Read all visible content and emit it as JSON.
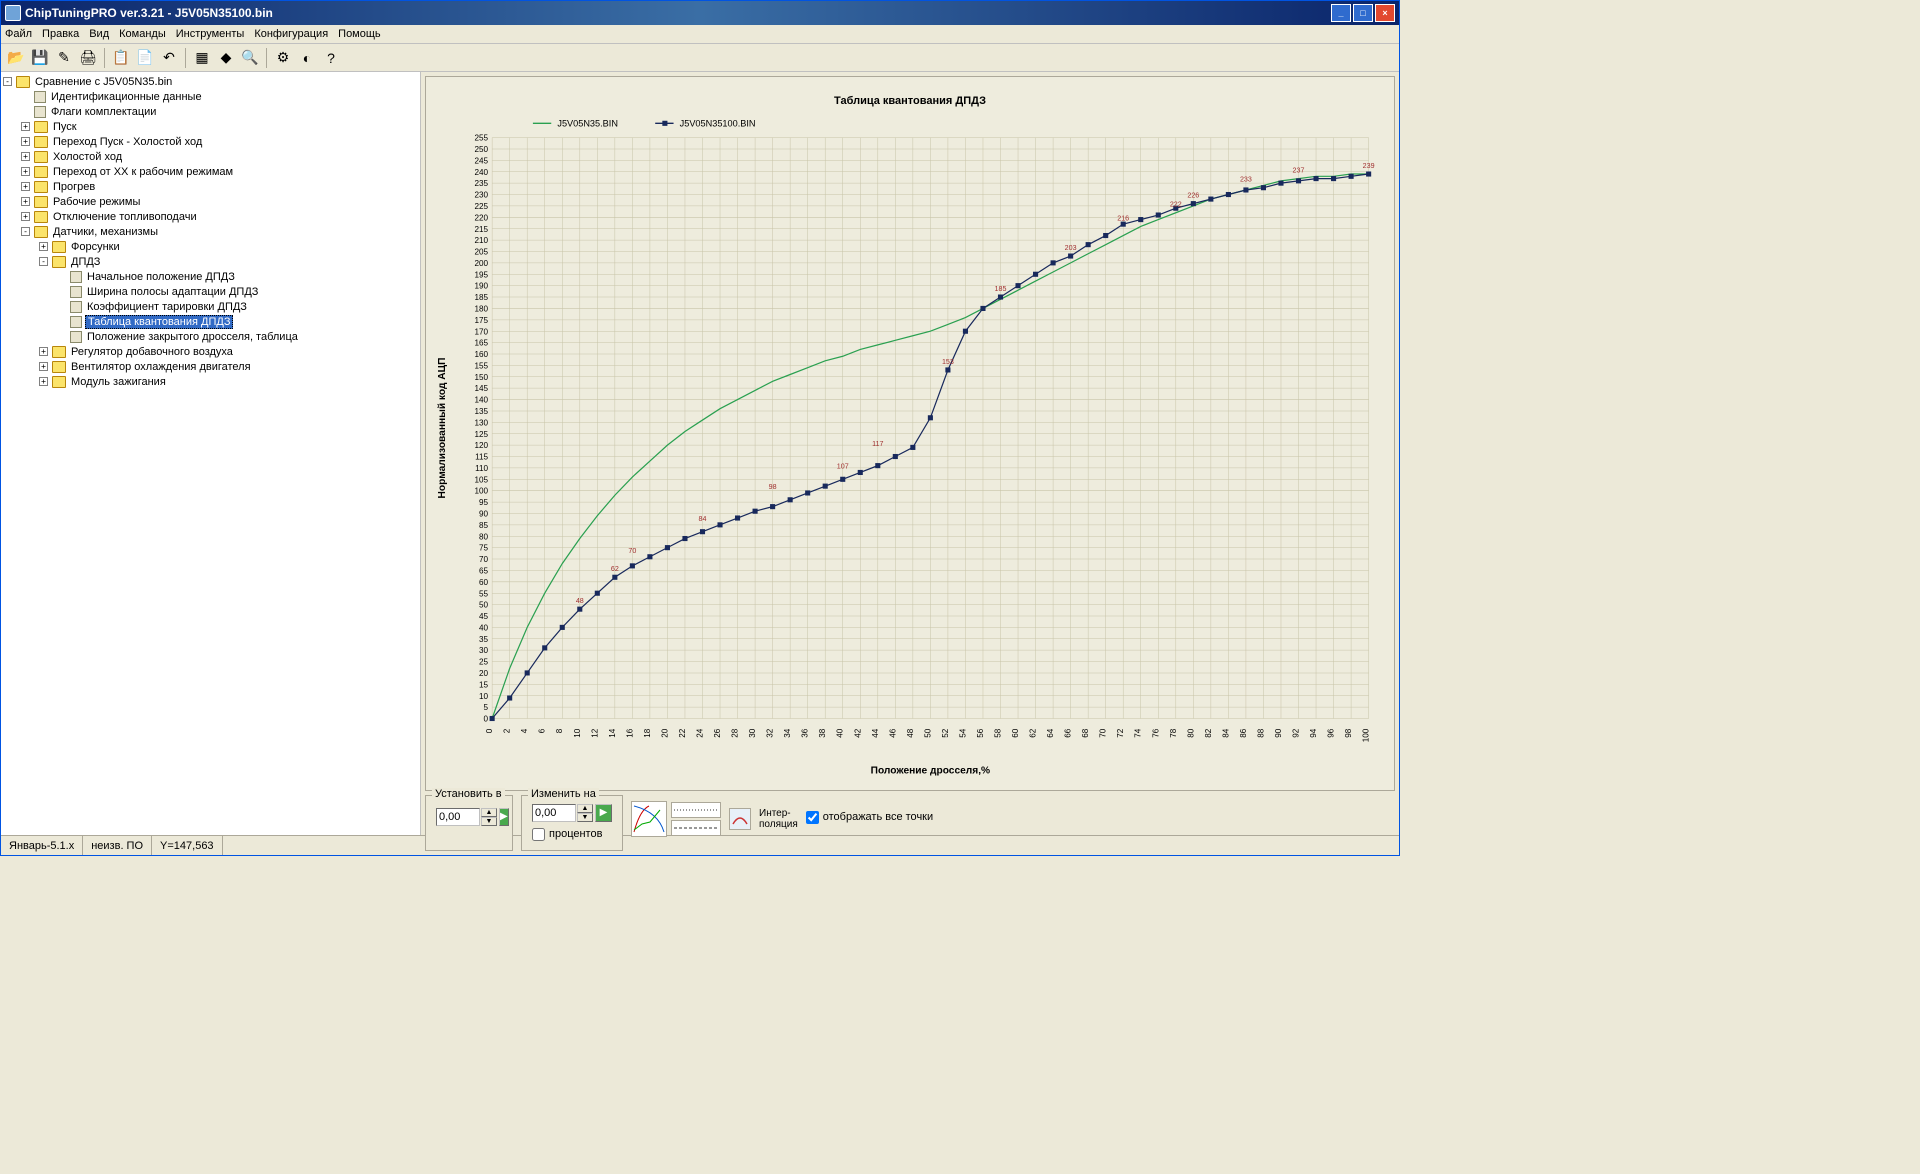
{
  "window_title": "ChipTuningPRO ver.3.21 - J5V05N35100.bin",
  "menu": [
    "Файл",
    "Правка",
    "Вид",
    "Команды",
    "Инструменты",
    "Конфигурация",
    "Помощь"
  ],
  "toolbar": [
    "open-icon",
    "save-icon",
    "edit-icon",
    "print-icon",
    "|",
    "copy-icon",
    "paste-icon",
    "undo-icon",
    "|",
    "grid-icon",
    "info-icon",
    "zoom-icon",
    "|",
    "tool1-icon",
    "tool2-icon",
    "help-icon"
  ],
  "tree": {
    "root": "Сравнение с J5V05N35.bin",
    "items": [
      {
        "depth": 1,
        "exp": "",
        "icon": "leaf",
        "label": "Идентификационные данные"
      },
      {
        "depth": 1,
        "exp": "",
        "icon": "leaf",
        "label": "Флаги комплектации"
      },
      {
        "depth": 1,
        "exp": "+",
        "icon": "folder",
        "label": "Пуск"
      },
      {
        "depth": 1,
        "exp": "+",
        "icon": "folder",
        "label": "Переход Пуск - Холостой ход"
      },
      {
        "depth": 1,
        "exp": "+",
        "icon": "folder",
        "label": "Холостой ход"
      },
      {
        "depth": 1,
        "exp": "+",
        "icon": "folder",
        "label": "Переход от ХХ к рабочим режимам"
      },
      {
        "depth": 1,
        "exp": "+",
        "icon": "folder",
        "label": "Прогрев"
      },
      {
        "depth": 1,
        "exp": "+",
        "icon": "folder",
        "label": "Рабочие режимы"
      },
      {
        "depth": 1,
        "exp": "+",
        "icon": "folder",
        "label": "Отключение топливоподачи"
      },
      {
        "depth": 1,
        "exp": "-",
        "icon": "folder",
        "label": "Датчики, механизмы"
      },
      {
        "depth": 2,
        "exp": "+",
        "icon": "folder",
        "label": "Форсунки"
      },
      {
        "depth": 2,
        "exp": "-",
        "icon": "folder",
        "label": "ДПДЗ"
      },
      {
        "depth": 3,
        "exp": "",
        "icon": "leaf",
        "label": "Начальное положение ДПДЗ"
      },
      {
        "depth": 3,
        "exp": "",
        "icon": "leaf",
        "label": "Ширина полосы адаптации ДПДЗ"
      },
      {
        "depth": 3,
        "exp": "",
        "icon": "leaf",
        "label": "Коэффициент тарировки ДПДЗ"
      },
      {
        "depth": 3,
        "exp": "",
        "icon": "leaf",
        "label": "Таблица квантования ДПДЗ",
        "selected": true
      },
      {
        "depth": 3,
        "exp": "",
        "icon": "leaf",
        "label": "Положение закрытого дросселя, таблица"
      },
      {
        "depth": 2,
        "exp": "+",
        "icon": "folder",
        "label": "Регулятор добавочного воздуха"
      },
      {
        "depth": 2,
        "exp": "+",
        "icon": "folder",
        "label": "Вентилятор охлаждения двигателя"
      },
      {
        "depth": 2,
        "exp": "+",
        "icon": "folder",
        "label": "Модуль зажигания"
      }
    ]
  },
  "chart_data": {
    "type": "line",
    "title": "Таблица квантования ДПДЗ",
    "xlabel": "Положение дросселя,%",
    "ylabel": "Нормализованный код АЦП",
    "x": [
      0,
      2,
      4,
      6,
      8,
      10,
      12,
      14,
      16,
      18,
      20,
      22,
      24,
      26,
      28,
      30,
      32,
      34,
      36,
      38,
      40,
      42,
      44,
      46,
      48,
      50,
      52,
      54,
      56,
      58,
      60,
      62,
      64,
      66,
      68,
      70,
      72,
      74,
      76,
      78,
      80,
      82,
      84,
      86,
      88,
      90,
      92,
      94,
      96,
      98,
      100
    ],
    "xlim": [
      0,
      100
    ],
    "ylim": [
      0,
      255
    ],
    "series": [
      {
        "name": "J5V05N35.BIN",
        "color": "#2aa050",
        "markers": false,
        "values": [
          0,
          22,
          40,
          55,
          68,
          79,
          89,
          98,
          106,
          113,
          120,
          126,
          131,
          136,
          140,
          144,
          148,
          151,
          154,
          157,
          159,
          162,
          164,
          166,
          168,
          170,
          173,
          176,
          180,
          184,
          188,
          192,
          196,
          200,
          204,
          208,
          212,
          216,
          219,
          222,
          225,
          228,
          230,
          232,
          234,
          236,
          237,
          238,
          238,
          239,
          239
        ]
      },
      {
        "name": "J5V05N35100.BIN",
        "color": "#18295c",
        "markers": true,
        "values": [
          0,
          9,
          20,
          31,
          40,
          48,
          55,
          62,
          67,
          71,
          75,
          79,
          82,
          85,
          88,
          91,
          93,
          96,
          99,
          102,
          105,
          108,
          111,
          115,
          119,
          132,
          153,
          170,
          180,
          185,
          190,
          195,
          200,
          203,
          208,
          212,
          217,
          219,
          221,
          224,
          226,
          228,
          230,
          232,
          233,
          235,
          236,
          237,
          237,
          238,
          239
        ]
      }
    ],
    "legend": [
      "J5V05N35.BIN",
      "J5V05N35100.BIN"
    ],
    "data_labels": [
      {
        "x": 10,
        "y": 48,
        "text": "48"
      },
      {
        "x": 14,
        "y": 62,
        "text": "62"
      },
      {
        "x": 16,
        "y": 70,
        "text": "70"
      },
      {
        "x": 24,
        "y": 84,
        "text": "84"
      },
      {
        "x": 32,
        "y": 98,
        "text": "98"
      },
      {
        "x": 40,
        "y": 107,
        "text": "107"
      },
      {
        "x": 44,
        "y": 117,
        "text": "117"
      },
      {
        "x": 52,
        "y": 153,
        "text": "153"
      },
      {
        "x": 58,
        "y": 185,
        "text": "185"
      },
      {
        "x": 66,
        "y": 203,
        "text": "203"
      },
      {
        "x": 72,
        "y": 216,
        "text": "216"
      },
      {
        "x": 78,
        "y": 222,
        "text": "222"
      },
      {
        "x": 80,
        "y": 226,
        "text": "226"
      },
      {
        "x": 86,
        "y": 233,
        "text": "233"
      },
      {
        "x": 92,
        "y": 237,
        "text": "237"
      },
      {
        "x": 100,
        "y": 239,
        "text": "239"
      }
    ]
  },
  "controls": {
    "set_label": "Установить в",
    "set_value": "0,00",
    "change_label": "Изменить на",
    "change_value": "0,00",
    "percent_label": "процентов",
    "interp_label": "Интер-\nполяция",
    "show_all_label": "отображать все точки",
    "show_all_checked": true
  },
  "statusbar": {
    "cell1": "Январь-5.1.x",
    "cell2": "неизв. ПО",
    "cell3": "Y=147,563"
  }
}
